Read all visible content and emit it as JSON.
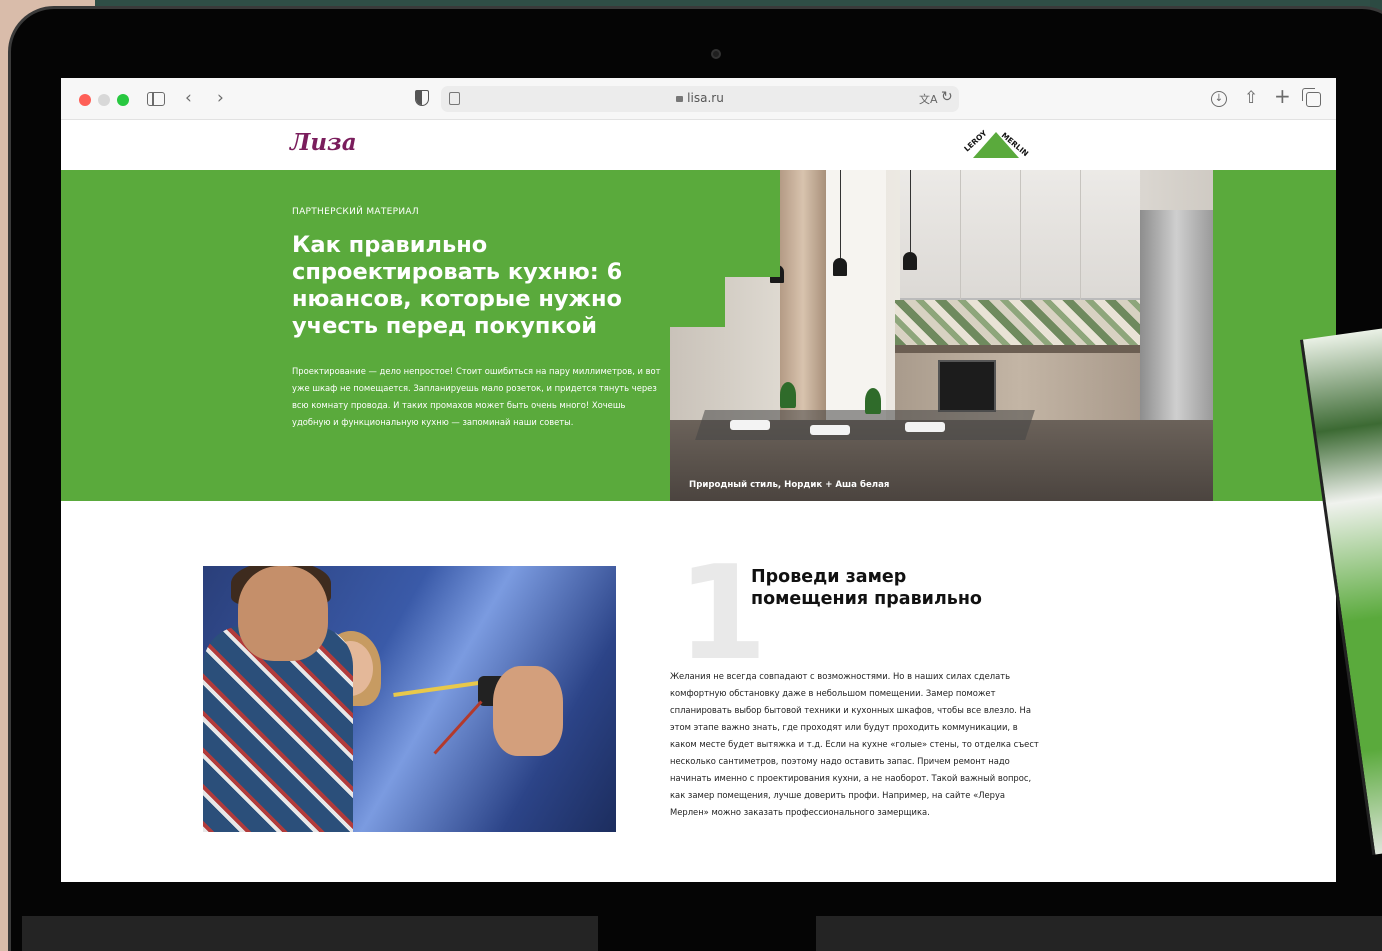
{
  "browser": {
    "url": "lisa.ru"
  },
  "site": {
    "logo": "Лиза",
    "partner_logo_top": "MERLIN",
    "partner_logo_left": "LEROY"
  },
  "hero": {
    "kicker": "ПАРТНЕРСКИЙ МАТЕРИАЛ",
    "title": "Как правильно спроектировать кухню: 6 нюансов, которые нужно учесть перед покупкой",
    "lead": "Проектирование — дело непростое! Стоит ошибиться на пару миллиметров, и вот уже шкаф не помещается. Запланируешь мало розеток, и придется тянуть через всю комнату провода. И таких промахов может быть очень много! Хочешь удобную и функциональную кухню — запоминай наши советы.",
    "photo_caption": "Природный стиль, Нордик + Аша белая"
  },
  "section1": {
    "number": "1",
    "title": "Проведи замер помещения правильно",
    "body": "Желания не всегда совпадают с возможностями. Но в наших силах сделать комфортную обстановку даже в небольшом помещении. Замер поможет спланировать выбор бытовой техники и кухонных шкафов, чтобы все влезло. На этом этапе важно знать, где проходят или будут проходить коммуникации, в каком месте будет вытяжка и т.д. Если на кухне «голые» стены, то отделка съест несколько сантиметров, поэтому надо оставить запас. Причем ремонт надо начинать именно с проектирования кухни, а не наоборот. Такой важный вопрос, как замер помещения, лучше доверить профи. Например, на сайте «Леруа Мерлен» можно заказать профессионального замерщика."
  },
  "colors": {
    "hero_green": "#5aaa3c",
    "logo_purple": "#7a1d5c"
  }
}
